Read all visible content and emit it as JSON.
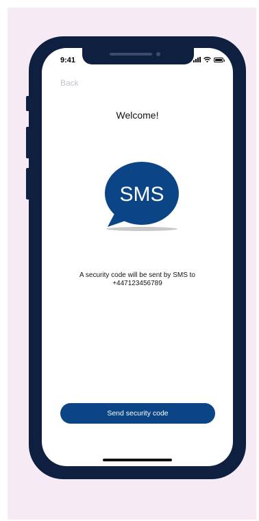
{
  "status_bar": {
    "time": "9:41"
  },
  "nav": {
    "back_label": "Back"
  },
  "content": {
    "title": "Welcome!",
    "sms_label": "SMS",
    "message_line1": "A security code will be sent by SMS to",
    "phone_number": "+447123456789"
  },
  "actions": {
    "send_label": "Send security code"
  },
  "colors": {
    "accent": "#0b4586",
    "device_frame": "#0e1f3f",
    "background": "#f6ebf4",
    "back_text": "#c0c4cc"
  },
  "icons": [
    "cellular-signal-icon",
    "wifi-icon",
    "battery-icon",
    "sms-speech-bubble-icon"
  ]
}
